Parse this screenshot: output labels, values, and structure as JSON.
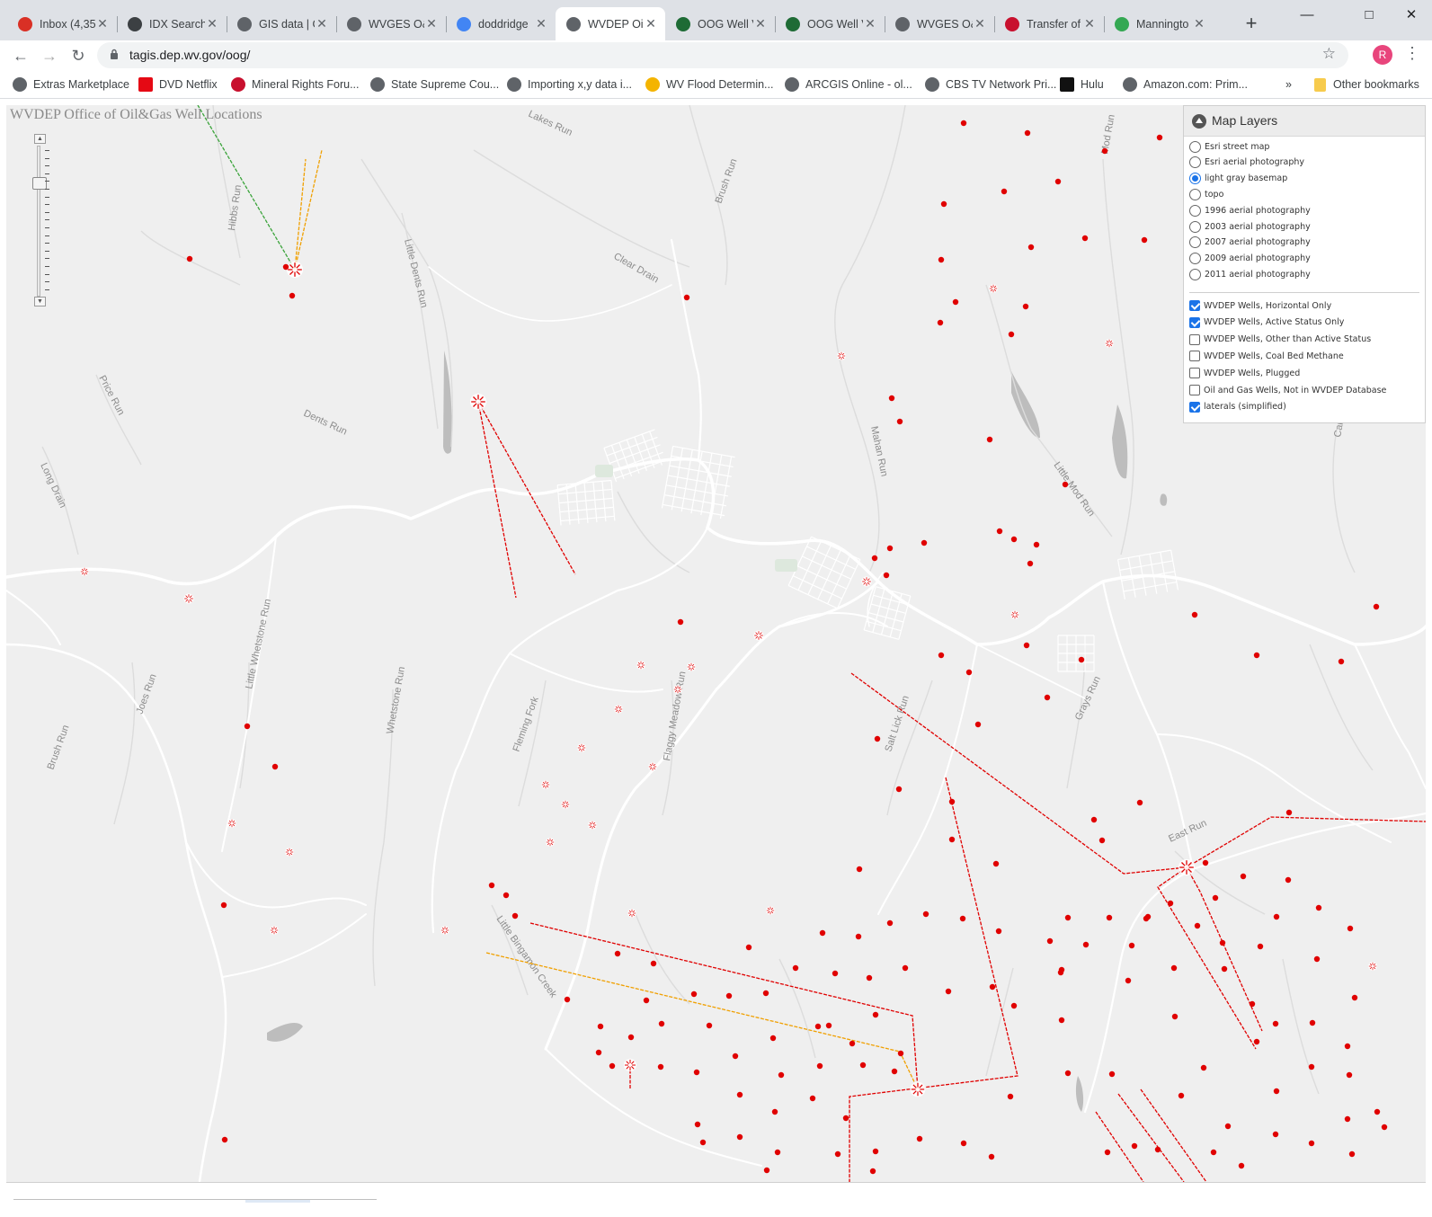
{
  "browser": {
    "tabs": [
      {
        "title": "Inbox (4,35",
        "icon": "gmail-icon",
        "color": "#d93025"
      },
      {
        "title": "IDX Search",
        "icon": "binoculars-icon",
        "color": "#3c4043"
      },
      {
        "title": "GIS data | G",
        "icon": "gis-icon",
        "color": "#5f6368"
      },
      {
        "title": "WVGES O&",
        "icon": "globe-icon",
        "color": "#5f6368"
      },
      {
        "title": "doddridge",
        "icon": "google-icon",
        "color": "#4285f4"
      },
      {
        "title": "WVDEP Oil",
        "icon": "globe-icon",
        "color": "#5f6368"
      },
      {
        "title": "OOG Well V",
        "icon": "oog-icon",
        "color": "#1e6b35"
      },
      {
        "title": "OOG Well V",
        "icon": "oog-icon",
        "color": "#1e6b35"
      },
      {
        "title": "WVGES O&",
        "icon": "globe-icon",
        "color": "#5f6368"
      },
      {
        "title": "Transfer of",
        "icon": "flag-icon",
        "color": "#c8102e"
      },
      {
        "title": "Manningto",
        "icon": "maps-icon",
        "color": "#34a853"
      }
    ],
    "active_tab": 5,
    "url": "tagis.dep.wv.gov/oog/",
    "profile_initial": "R",
    "bookmarks": [
      "Extras Marketplace",
      "DVD Netflix",
      "Mineral Rights Foru...",
      "State Supreme Cou...",
      "Importing x,y data i...",
      "WV Flood Determin...",
      "ARCGIS Online - ol...",
      "CBS TV Network Pri...",
      "Hulu",
      "Amazon.com: Prim..."
    ],
    "other_bookmarks": "Other bookmarks",
    "overflow": "»"
  },
  "map": {
    "title": "WVDEP Office of Oil&Gas Well Locations",
    "colors": {
      "background": "#efefef",
      "road": "#ffffff",
      "well": "#e00000",
      "lateral": "#e00000",
      "lateral_alt": "#f0a000",
      "water": "#bdbdbd"
    },
    "stream_labels": [
      "Lakes Run",
      "Hibbs Run",
      "Little Dents Run",
      "Brush Run",
      "Clear Drain",
      "Mod Run",
      "Price Run",
      "Dents Run",
      "Long Drain",
      "Mahan Run",
      "Little Mod Run",
      "Little Whetstone Run",
      "Joes Run",
      "Whetstone Run",
      "Brush Run",
      "Fleming Fork",
      "Flaggy Meadow Run",
      "Salt Lick Run",
      "Grays Run",
      "East Run",
      "Little Bingamon Creek",
      "Carberry"
    ]
  },
  "layers_panel": {
    "title": "Map Layers",
    "basemaps": [
      {
        "label": "Esri street map",
        "selected": false
      },
      {
        "label": "Esri aerial photography",
        "selected": false
      },
      {
        "label": "light gray basemap",
        "selected": true
      },
      {
        "label": "topo",
        "selected": false
      },
      {
        "label": "1996 aerial photography",
        "selected": false
      },
      {
        "label": "2003 aerial photography",
        "selected": false
      },
      {
        "label": "2007 aerial photography",
        "selected": false
      },
      {
        "label": "2009 aerial photography",
        "selected": false
      },
      {
        "label": "2011 aerial photography",
        "selected": false
      }
    ],
    "overlays": [
      {
        "label": "WVDEP Wells, Horizontal Only",
        "checked": true
      },
      {
        "label": "WVDEP Wells, Active Status Only",
        "checked": true
      },
      {
        "label": "WVDEP Wells, Other than Active Status",
        "checked": false
      },
      {
        "label": "WVDEP Wells, Coal Bed Methane",
        "checked": false
      },
      {
        "label": "WVDEP Wells, Plugged",
        "checked": false
      },
      {
        "label": "Oil and Gas Wells, Not in WVDEP Database",
        "checked": false
      },
      {
        "label": "laterals (simplified)",
        "checked": true
      }
    ]
  }
}
